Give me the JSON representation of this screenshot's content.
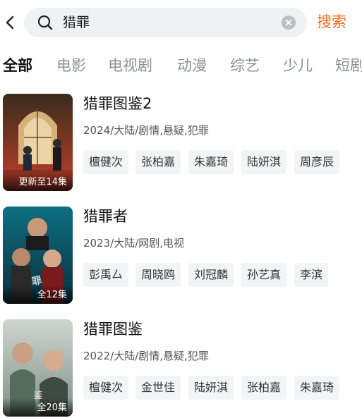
{
  "search": {
    "query": "猎罪",
    "submit_label": "搜索"
  },
  "tabs": [
    {
      "label": "全部",
      "active": true
    },
    {
      "label": "电影"
    },
    {
      "label": "电视剧"
    },
    {
      "label": "动漫"
    },
    {
      "label": "综艺"
    },
    {
      "label": "少儿"
    },
    {
      "label": "短剧"
    }
  ],
  "results": [
    {
      "title": "猎罪图鉴2",
      "meta": "2024/大陆/剧情,悬疑,犯罪",
      "badge": "更新至14集",
      "cast": [
        "檀健次",
        "张柏嘉",
        "朱嘉琦",
        "陆妍淇",
        "周彦辰"
      ]
    },
    {
      "title": "猎罪者",
      "meta": "2023/大陆/网剧,电视",
      "badge": "全12集",
      "cast": [
        "彭禹厶",
        "周晓鸥",
        "刘冠麟",
        "孙艺真",
        "李滨"
      ]
    },
    {
      "title": "猎罪图鉴",
      "meta": "2022/大陆/剧情,悬疑,犯罪",
      "badge": "全20集",
      "cast": [
        "檀健次",
        "金世佳",
        "陆妍淇",
        "张柏嘉",
        "朱嘉琦"
      ]
    }
  ],
  "colors": {
    "accent": "#ff6a1a",
    "tag_bg": "#f3f4f6",
    "search_bg": "#f0f1f3"
  }
}
